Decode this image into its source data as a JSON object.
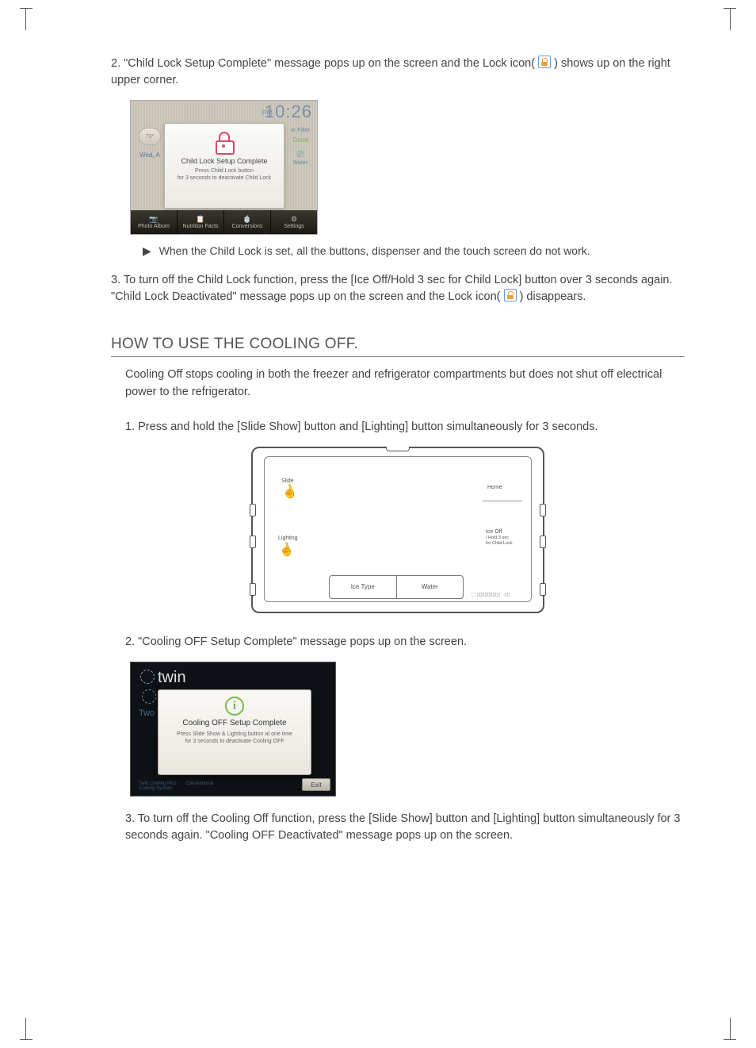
{
  "steps_top": {
    "s2_num": "2.",
    "s2_a": "\"Child Lock Setup Complete\" message pops up on the screen and the Lock icon( ",
    "s2_b": " ) shows up on the right upper corner.",
    "note_arrow": "▶",
    "note": "When the Child Lock is set, all the buttons, dispenser and the touch screen do not work.",
    "s3_num": "3.",
    "s3_a": "To turn off the Child Lock function, press the [Ice Off/Hold 3 sec for Child Lock] button over 3 seconds again. \"Child Lock Deactivated\" message pops up on the screen and the Lock icon( ",
    "s3_b": " ) disappears."
  },
  "fig1": {
    "time_pm": "PM",
    "time": "10:26",
    "temp": "73°",
    "date": "Wed, A",
    "filter": "er Filter",
    "good": "Good",
    "water": "Water",
    "popup_title": "Child Lock Setup Complete",
    "popup_sub1": "Press Child Lock button",
    "popup_sub2": "for 3 seconds to deactivate Child Lock",
    "tabs": [
      "Photo Album",
      "Nutrition Facts",
      "Conversions",
      "Settings"
    ],
    "tab_icons": [
      "📷",
      "📋",
      "🍵",
      "⚙"
    ]
  },
  "section": {
    "heading": "HOW TO USE THE COOLING OFF.",
    "intro": "Cooling Off stops cooling in both the freezer and refrigerator compartments but does not shut off electrical power to the refrigerator.",
    "s1_num": "1.",
    "s1": "Press and hold the [Slide Show] button and [Lighting] button simultaneously for 3 seconds.",
    "s2_num": "2.",
    "s2": "\"Cooling OFF Setup Complete\" message pops up on the screen.",
    "s3_num": "3.",
    "s3": "To turn off the Cooling Off function, press the [Slide Show] button and [Lighting] button simultaneously for 3 seconds again. \"Cooling OFF Deactivated\" message pops up on the screen."
  },
  "fig2": {
    "slide": "Slide",
    "lighting": "Lighting",
    "home": "Home",
    "iceoff": "Ice Off",
    "iceoff_sub": "/ Hold 3 sec\nfor Child Lock",
    "icetype": "Ice Type",
    "water": "Water"
  },
  "fig3": {
    "twin": "twin",
    "sub": "Two sep",
    "popup_title": "Cooling OFF Setup Complete",
    "popup_sub1": "Press Slide Show & Lighting button at one time",
    "popup_sub2": "for 3 seconds to deactivate Cooling OFF",
    "exit": "Exit",
    "bottom1": "Twin Cooling Plus",
    "bottom2": "Conventional\nCooling System"
  }
}
